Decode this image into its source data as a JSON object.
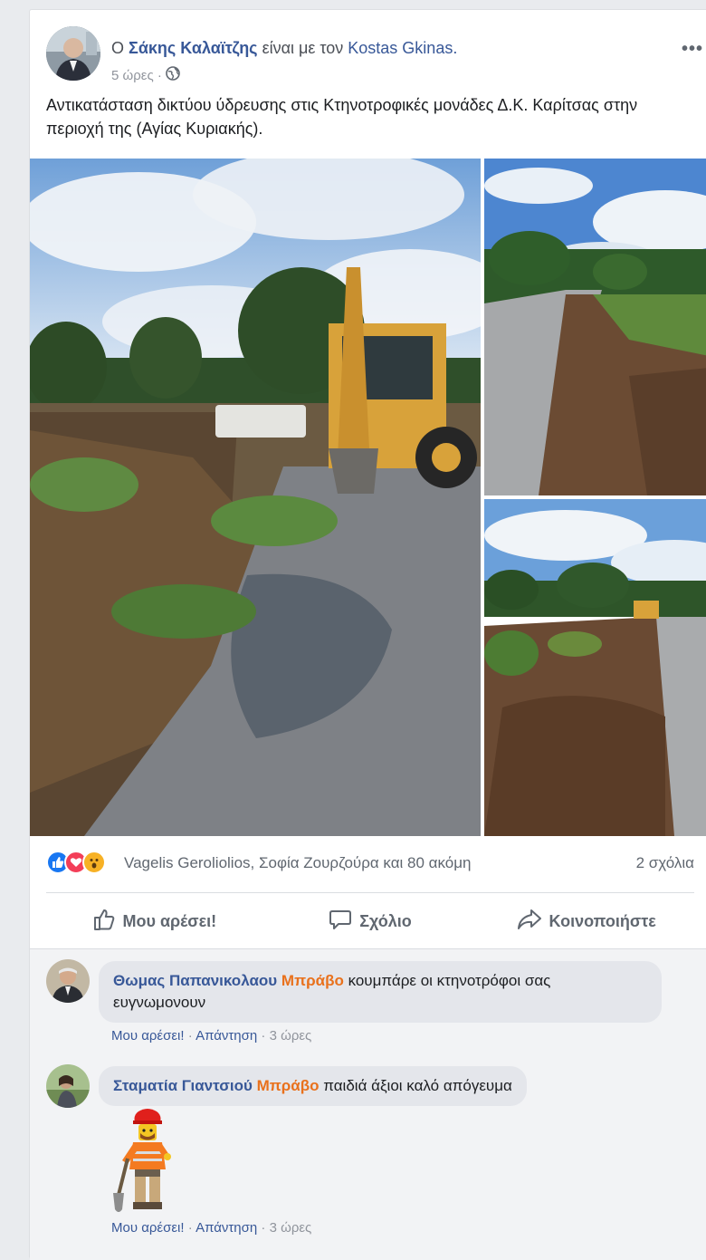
{
  "post": {
    "prefix": "Ο",
    "author": "Σάκης Καλαϊτζης",
    "with_text": "είναι με τον",
    "tagged": "Kostas Gkinas.",
    "time": "5 ώρες ·",
    "menu": "•••",
    "text": "Αντικατάσταση δικτύου ύδρευσης στις Κτηνοτροφικές μονάδες Δ.Κ. Καρίτσας στην περιοχή της (Αγίας Κυριακής)."
  },
  "reactions": {
    "icons": [
      "like-icon",
      "love-icon",
      "wow-icon"
    ],
    "names": "Vagelis Geroliolios, Σοφία Ζουρζούρα και 80 ακόμη",
    "comment_count": "2 σχόλια"
  },
  "actions": {
    "like": "Μου αρέσει!",
    "comment": "Σχόλιο",
    "share": "Κοινοποιήστε"
  },
  "comments": [
    {
      "name": "Θωμας Παπανικολαου",
      "highlight": "Μπράβο",
      "text": "κουμπάρε οι κτηνοτρόφοι σας ευγνωμονουν",
      "like": "Μου αρέσει!",
      "reply": "Απάντηση",
      "time": "3 ώρες"
    },
    {
      "name": "Σταματία Γιαντσιού",
      "highlight": "Μπράβο",
      "text": "παιδιά άξιοι καλό απόγευμα",
      "like": "Μου αρέσει!",
      "reply": "Απάντηση",
      "time": "3 ώρες"
    }
  ],
  "colors": {
    "link": "#385898",
    "highlight": "#e9711c",
    "like": "#1877f2",
    "love": "#f33e58",
    "wow": "#f7b125"
  }
}
